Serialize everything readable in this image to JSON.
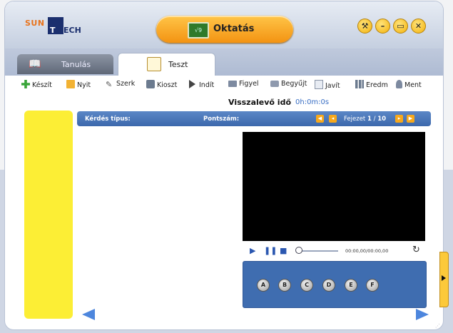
{
  "app": {
    "logo": {
      "part1": "SUN",
      "part2": "T",
      "part3": "ECH"
    },
    "title": "Oktatás",
    "title_icon": "blackboard-icon",
    "window_controls": [
      {
        "name": "settings",
        "glyph": "🔧"
      },
      {
        "name": "minimize",
        "glyph": "–"
      },
      {
        "name": "restore",
        "glyph": "▭"
      },
      {
        "name": "close",
        "glyph": "✕"
      }
    ]
  },
  "tabs": [
    {
      "label": "Tanulás",
      "icon": "book-icon",
      "active": false
    },
    {
      "label": "Teszt",
      "icon": "notepad-icon",
      "active": true
    }
  ],
  "toolbar": {
    "items": [
      {
        "label": "Készít",
        "icon": "plus-icon",
        "color": "#3aa53a"
      },
      {
        "label": "Nyit",
        "icon": "folder-icon",
        "color": "#f2b233"
      },
      {
        "label": "Szerk",
        "icon": "pencil-icon",
        "color": "#6c7b8f"
      },
      {
        "label": "Kioszt",
        "icon": "bus-icon",
        "color": "#6c7b8f"
      },
      {
        "label": "Indít",
        "icon": "play-icon",
        "color": "#444"
      },
      {
        "label": "Figyel",
        "icon": "monitor-icon",
        "color": "#6c7b8f"
      },
      {
        "label": "Begyűjt",
        "icon": "tray-icon",
        "color": "#6c7b8f"
      },
      {
        "label": "Javít",
        "icon": "checklist-icon",
        "color": "#6c7b8f"
      },
      {
        "label": "Eredm",
        "icon": "chart-icon",
        "color": "#6c7b8f"
      },
      {
        "label": "Ment",
        "icon": "save-icon",
        "color": "#6c7b8f"
      }
    ]
  },
  "timer": {
    "label": "Visszalevő idő",
    "value": "0h:0m:0s"
  },
  "question_bar": {
    "type_label": "Kérdés típus:",
    "score_label": "Pontszám:",
    "chapter_label": "Fejezet",
    "chapter_current": "1",
    "chapter_sep": "/",
    "chapter_total": "10"
  },
  "video": {
    "time": "00:00,00/00:00,00",
    "progress": 0
  },
  "answers": [
    "A",
    "B",
    "C",
    "D",
    "E",
    "F"
  ],
  "colors": {
    "accent_blue": "#3f6db0",
    "yellow_panel": "#fcee35",
    "title_orange": "#f39312"
  }
}
